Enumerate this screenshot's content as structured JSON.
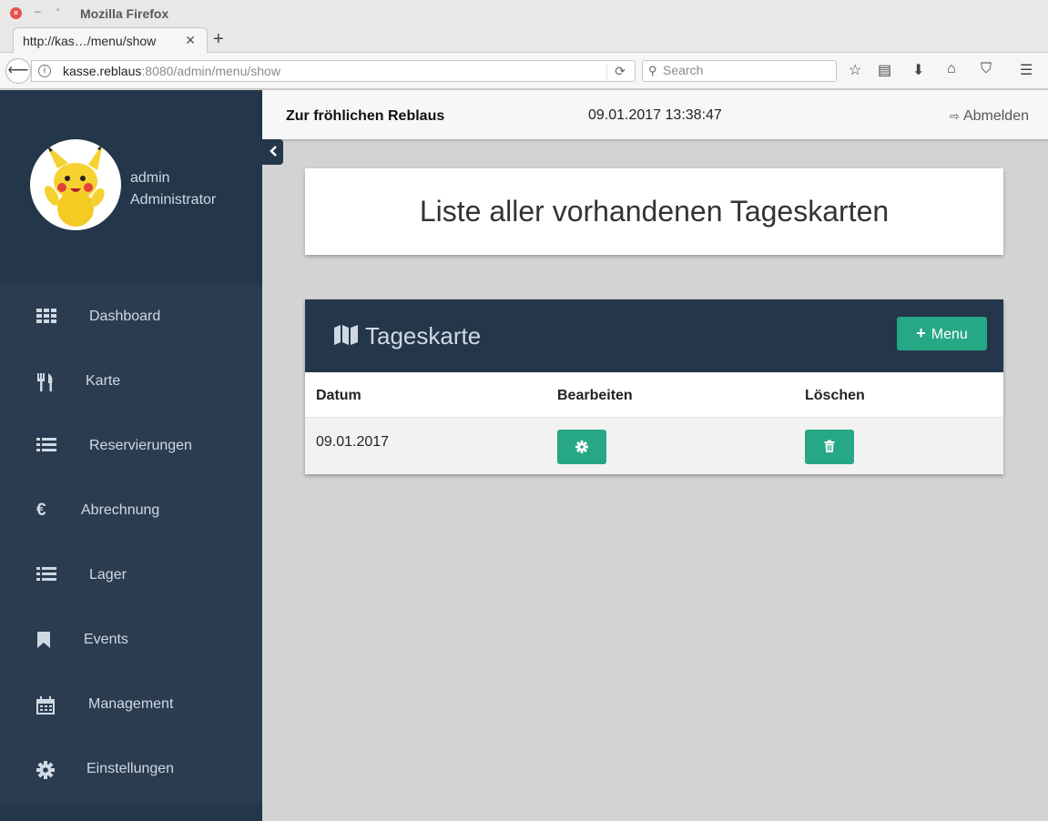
{
  "browser": {
    "window_title": "Mozilla Firefox",
    "tab_title": "http://kas…/menu/show",
    "url_host": "kasse.reblaus",
    "url_rest": ":8080/admin/menu/show",
    "search_placeholder": "Search"
  },
  "sidebar": {
    "user_name": "admin",
    "user_role": "Administrator",
    "items": [
      {
        "label": "Dashboard",
        "icon": "grid-icon"
      },
      {
        "label": "Karte",
        "icon": "cutlery-icon"
      },
      {
        "label": "Reservierungen",
        "icon": "list-icon"
      },
      {
        "label": "Abrechnung",
        "icon": "euro-icon"
      },
      {
        "label": "Lager",
        "icon": "list-icon"
      },
      {
        "label": "Events",
        "icon": "bookmark-icon"
      },
      {
        "label": "Management",
        "icon": "calendar-icon"
      },
      {
        "label": "Einstellungen",
        "icon": "gear-icon"
      }
    ]
  },
  "header": {
    "brand": "Zur fröhlichen Reblaus",
    "datetime": "09.01.2017 13:38:47",
    "logout_label": "Abmelden"
  },
  "main": {
    "page_title": "Liste aller vorhandenen Tageskarten",
    "card_title": "Tageskarte",
    "add_button_label": "Menu",
    "columns": [
      "Datum",
      "Bearbeiten",
      "Löschen"
    ],
    "rows": [
      {
        "datum": "09.01.2017"
      }
    ]
  },
  "colors": {
    "sidebar": "#2b3c50",
    "sidebar_dark": "#24364a",
    "accent": "#26a785",
    "page_bg": "#d3d3d3"
  }
}
